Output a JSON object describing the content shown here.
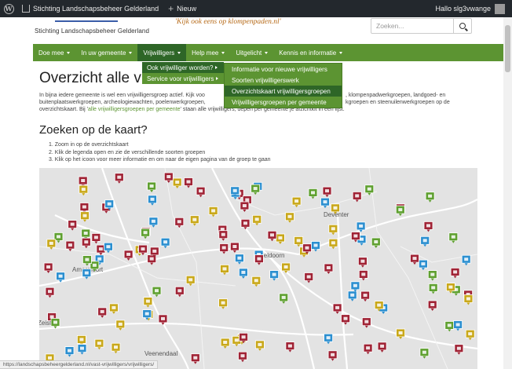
{
  "adminbar": {
    "site_name": "Stichting Landschapsbeheer Gelderland",
    "new_label": "Nieuw",
    "greeting": "Hallo slg3vwange"
  },
  "header": {
    "logo_text": "Stichting Landschapsbeheer Gelderland",
    "slogan": "'Kijk ook eens op klompenpaden.nl'",
    "search_placeholder": "Zoeken..."
  },
  "nav": {
    "items": [
      {
        "label": "Doe mee"
      },
      {
        "label": "In uw gemeente"
      },
      {
        "label": "Vrijwilligers"
      },
      {
        "label": "Help mee"
      },
      {
        "label": "Uitgelicht"
      },
      {
        "label": "Kennis en informatie"
      }
    ]
  },
  "dropdown": {
    "level1": [
      {
        "label": "Ook vrijwilliger worden?"
      },
      {
        "label": "Service voor vrijwilligers"
      }
    ],
    "level2": [
      {
        "label": "Informatie voor nieuwe vrijwilligers"
      },
      {
        "label": "Soorten vrijwilligerswerk"
      },
      {
        "label": "Overzichtskaart vrijwilligersgroepen"
      },
      {
        "label": "Vrijwilligersgroepen per gemeente"
      }
    ]
  },
  "page": {
    "title": "Overzicht alle vr",
    "intro_line1_a": "In bijna iedere gemeente is wel een vrijwilligersgroep actief. Kijk voo",
    "intro_line1_b": ", klompenpadwerkgroepen, landgoed- en",
    "intro_line2_a": "buitenplaatswerkgroepen, archeologiewachten, poelenwerkgroepen, ",
    "intro_line2_b": "kgroepen en steenuilenwerkgroepen op de",
    "intro_line3_a": "overzichtskaart. Bij '",
    "intro_link": "alle vrijwilligersgroepen per gemeente",
    "intro_line3_b": "' staan alle vrijwilligers, ",
    "intro_line3_c": "depen per gemeente je afzichtkit in een lijst.",
    "map_heading": "Zoeken op de kaart?",
    "steps": [
      "1. Zoom in op de overzichtskaart",
      "2. Klik de legenda open en zie de verschillende soorten groepen",
      "3. Klik op het icoon  voor meer informatie en om naar de eigen pagina van de groep te gaan"
    ]
  },
  "map": {
    "place_labels": [
      "Amersfoort",
      "Apeldoorn",
      "Deventer",
      "Zeist",
      "Veenendaal"
    ],
    "marker_colors": {
      "red": "#a02335",
      "yellow": "#c9a81a",
      "blue": "#2b8fd0",
      "green": "#5fa030"
    }
  },
  "statusbar": {
    "url": "https://landschapsbeheergelderland.nl/vast-vrijwilligers/vrijwilligers/"
  }
}
